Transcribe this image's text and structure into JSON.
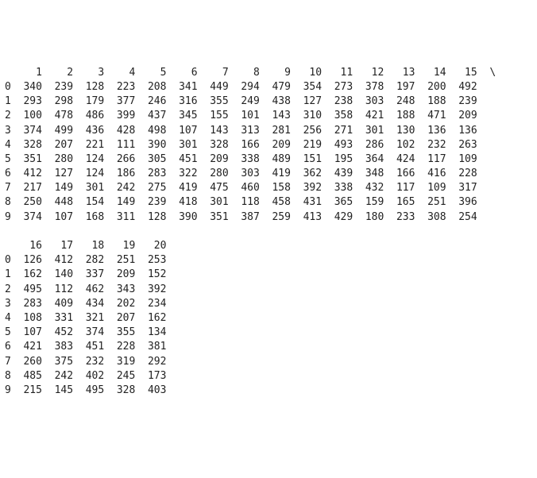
{
  "chart_data": {
    "type": "table",
    "title": "",
    "columns": [
      1,
      2,
      3,
      4,
      5,
      6,
      7,
      8,
      9,
      10,
      11,
      12,
      13,
      14,
      15,
      16,
      17,
      18,
      19,
      20
    ],
    "index": [
      0,
      1,
      2,
      3,
      4,
      5,
      6,
      7,
      8,
      9
    ],
    "rows": [
      [
        340,
        239,
        128,
        223,
        208,
        341,
        449,
        294,
        479,
        354,
        273,
        378,
        197,
        200,
        492,
        126,
        412,
        282,
        251,
        253
      ],
      [
        293,
        298,
        179,
        377,
        246,
        316,
        355,
        249,
        438,
        127,
        238,
        303,
        248,
        188,
        239,
        162,
        140,
        337,
        209,
        152
      ],
      [
        100,
        478,
        486,
        399,
        437,
        345,
        155,
        101,
        143,
        310,
        358,
        421,
        188,
        471,
        209,
        495,
        112,
        462,
        343,
        392
      ],
      [
        374,
        499,
        436,
        428,
        498,
        107,
        143,
        313,
        281,
        256,
        271,
        301,
        130,
        136,
        136,
        283,
        409,
        434,
        202,
        234
      ],
      [
        328,
        207,
        221,
        111,
        390,
        301,
        328,
        166,
        209,
        219,
        493,
        286,
        102,
        232,
        263,
        108,
        331,
        321,
        207,
        162
      ],
      [
        351,
        280,
        124,
        266,
        305,
        451,
        209,
        338,
        489,
        151,
        195,
        364,
        424,
        117,
        109,
        107,
        452,
        374,
        355,
        134
      ],
      [
        412,
        127,
        124,
        186,
        283,
        322,
        280,
        303,
        419,
        362,
        439,
        348,
        166,
        416,
        228,
        421,
        383,
        451,
        228,
        381
      ],
      [
        217,
        149,
        301,
        242,
        275,
        419,
        475,
        460,
        158,
        392,
        338,
        432,
        117,
        109,
        317,
        260,
        375,
        232,
        319,
        292
      ],
      [
        250,
        448,
        154,
        149,
        239,
        418,
        301,
        118,
        458,
        431,
        365,
        159,
        165,
        251,
        396,
        485,
        242,
        402,
        245,
        173
      ],
      [
        374,
        107,
        168,
        311,
        128,
        390,
        351,
        387,
        259,
        413,
        429,
        180,
        233,
        308,
        254,
        215,
        145,
        495,
        328,
        403
      ]
    ],
    "block1_cols": 15,
    "block2_cols": 5,
    "continuation_marker": "\\"
  }
}
